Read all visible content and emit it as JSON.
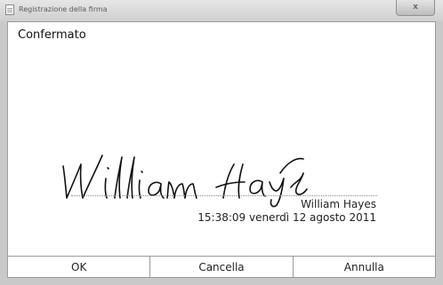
{
  "window": {
    "title": "Registrazione della firma",
    "close_symbol": "x"
  },
  "status": "Confermato",
  "signature": {
    "signer_name": "William Hayes",
    "timestamp": "15:38:09 venerdì 12 agosto 2011",
    "image": "handwritten-signature"
  },
  "buttons": {
    "ok": "OK",
    "clear": "Cancella",
    "cancel": "Annulla"
  },
  "colors": {
    "titlebar": "#d8d8d8",
    "frame": "#c9c9c9",
    "ink": "#111111"
  },
  "icons": [
    "document-icon",
    "close-icon"
  ]
}
